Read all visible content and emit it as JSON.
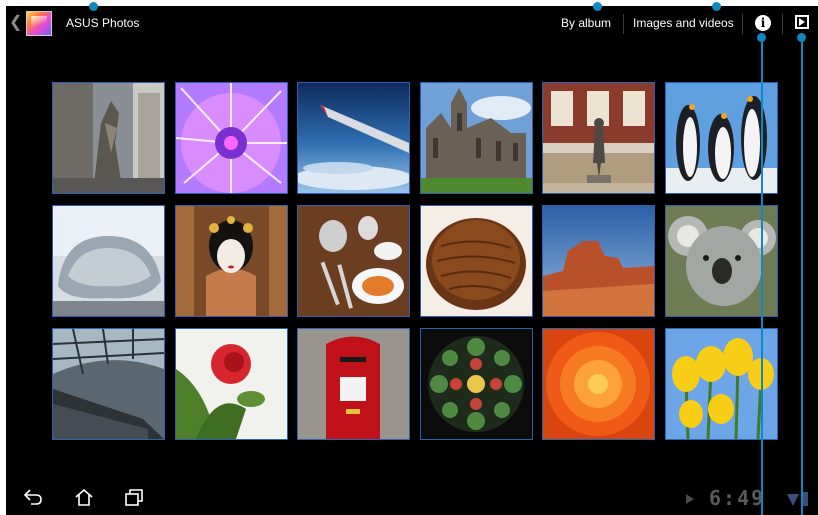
{
  "actionbar": {
    "back_icon": "chevron-left-icon",
    "app_icon": "asus-photos-icon",
    "title": "ASUS Photos",
    "by_album_label": "By album",
    "images_videos_label": "Images and videos",
    "info_icon": "info-icon",
    "slideshow_icon": "slideshow-icon"
  },
  "gallery": {
    "thumbnails": [
      {
        "subject": "sculpture"
      },
      {
        "subject": "purple-flower-abstract"
      },
      {
        "subject": "airplane-wing-sky"
      },
      {
        "subject": "cathedral"
      },
      {
        "subject": "street-statue"
      },
      {
        "subject": "penguins"
      },
      {
        "subject": "cloud-gate-bean"
      },
      {
        "subject": "geisha"
      },
      {
        "subject": "tea-table"
      },
      {
        "subject": "chocolate-cake"
      },
      {
        "subject": "desert-mesa"
      },
      {
        "subject": "koala"
      },
      {
        "subject": "escalator-tunnel"
      },
      {
        "subject": "red-rose"
      },
      {
        "subject": "red-postbox"
      },
      {
        "subject": "rose-window"
      },
      {
        "subject": "orange-dahlia"
      },
      {
        "subject": "yellow-tulips"
      }
    ]
  },
  "systembar": {
    "back_icon": "back-icon",
    "home_icon": "home-icon",
    "recent_icon": "recent-apps-icon",
    "time": "6:49",
    "wifi_icon": "wifi-icon",
    "battery_icon": "battery-icon"
  },
  "colors": {
    "background": "#000000",
    "thumb_border": "#2f5fb0",
    "callout": "#0d8ac2"
  }
}
